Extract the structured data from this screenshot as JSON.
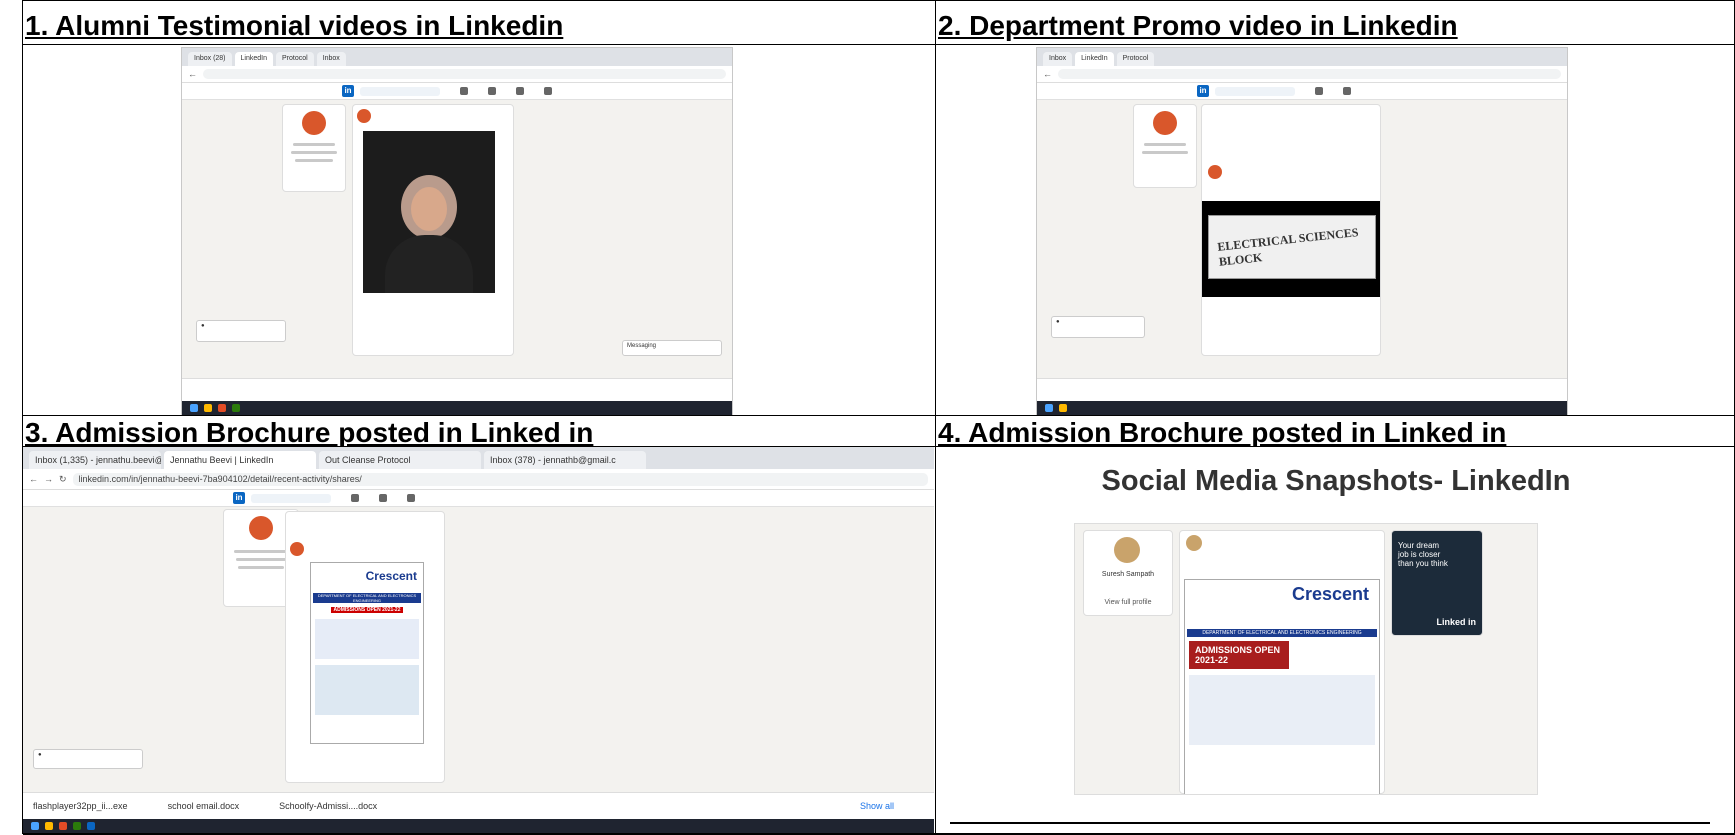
{
  "headings": {
    "h1": "1. Alumni Testimonial videos in Linkedin",
    "h2": "2. Department Promo video in Linkedin",
    "h3": "3. Admission Brochure posted in Linked in",
    "h4": "4. Admission Brochure posted in Linked in"
  },
  "panel3": {
    "tabs": [
      "Inbox (1,335) - jennathu.beevi@",
      "Jennathu Beevi | LinkedIn",
      "Out Cleanse Protocol",
      "Inbox (378) - jennathb@gmail.c"
    ],
    "url": "linkedin.com/in/jennathu-beevi-7ba904102/detail/recent-activity/shares/",
    "brochure_brand": "Crescent",
    "brochure_banner": "DEPARTMENT OF ELECTRICAL AND ELECTRONICS ENGINEERING",
    "brochure_admissions": "ADMISSIONS OPEN 2021-22",
    "downloads": [
      "flashplayer32pp_ii...exe",
      "school email.docx",
      "Schoolfy-Admissi....docx"
    ],
    "show_all": "Show all"
  },
  "panel4": {
    "title": "Social Media Snapshots- LinkedIn",
    "profile_name": "Suresh Sampath",
    "view_profile": "View full profile",
    "brand": "Crescent",
    "banner": "DEPARTMENT OF ELECTRICAL AND ELECTRONICS ENGINEERING",
    "admissions": "ADMISSIONS OPEN 2021-22",
    "ad_text": "Your dream job is closer than you think",
    "ad_brand": "Linked in"
  },
  "panel1": {
    "messaging": "Messaging"
  },
  "panel2": {
    "block_sign": "ELECTRICAL SCIENCES BLOCK"
  }
}
